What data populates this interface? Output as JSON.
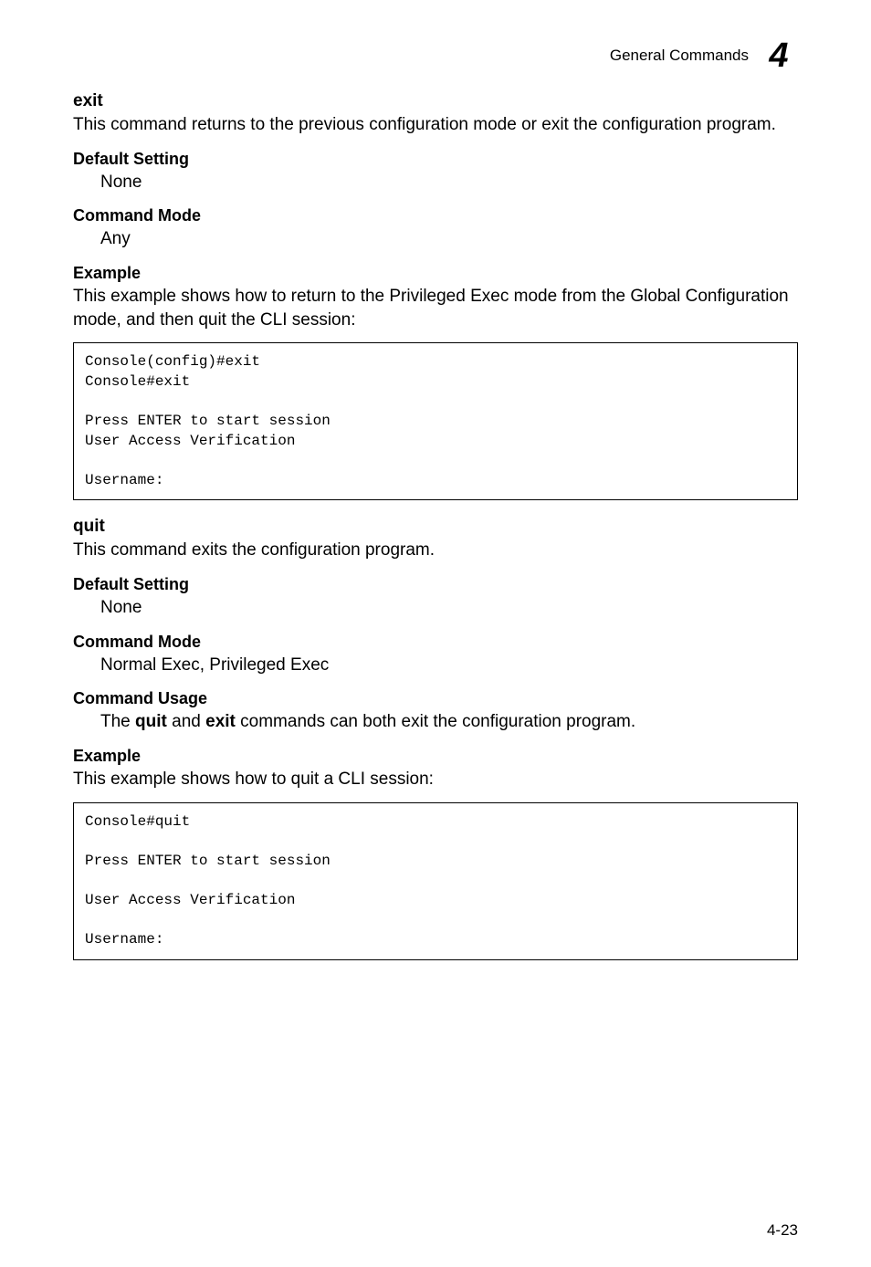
{
  "header": {
    "section_title": "General Commands",
    "chapter_number": "4"
  },
  "cmd1": {
    "name": "exit",
    "description": "This command returns to the previous configuration mode or exit the configuration program.",
    "default_heading": "Default Setting",
    "default_value": "None",
    "mode_heading": "Command Mode",
    "mode_value": "Any",
    "example_heading": "Example",
    "example_intro": "This example shows how to return to the Privileged Exec mode from the Global Configuration mode, and then quit the CLI session:",
    "code": "Console(config)#exit\nConsole#exit\n\nPress ENTER to start session\nUser Access Verification\n\nUsername:"
  },
  "cmd2": {
    "name": "quit",
    "description": "This command exits the configuration program.",
    "default_heading": "Default Setting",
    "default_value": "None",
    "mode_heading": "Command Mode",
    "mode_value": "Normal Exec, Privileged Exec",
    "usage_heading": "Command Usage",
    "usage_prefix": "The ",
    "usage_bold1": "quit",
    "usage_mid": " and ",
    "usage_bold2": "exit",
    "usage_suffix": " commands can both exit the configuration program.",
    "example_heading": "Example",
    "example_intro": "This example shows how to quit a CLI session:",
    "code": "Console#quit\n\nPress ENTER to start session\n\nUser Access Verification\n\nUsername:"
  },
  "footer": {
    "page_number": "4-23"
  }
}
